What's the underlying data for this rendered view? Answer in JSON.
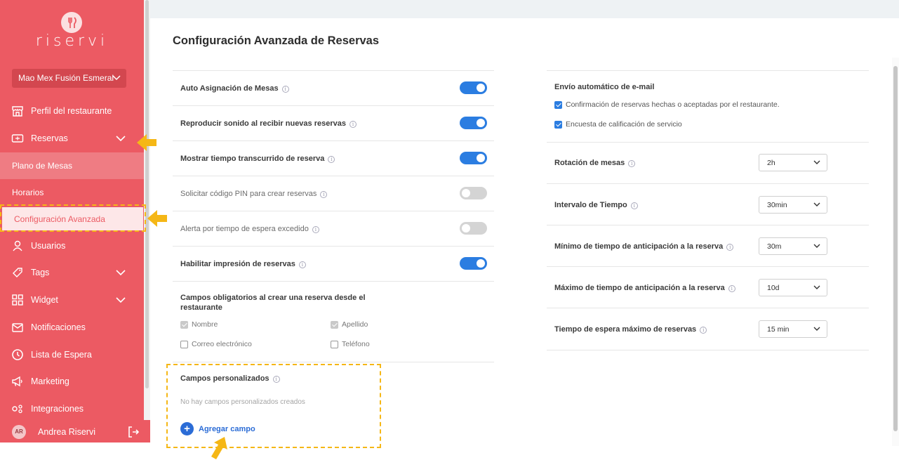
{
  "brand": {
    "name": "riservi",
    "color": "#ec5a63",
    "accent": "#2b7de1",
    "highlight": "#f5b716"
  },
  "sidebar": {
    "restaurant": "Mao Mex Fusión Esmeral",
    "items": [
      {
        "label": "Perfil del restaurante",
        "icon": "storefront-icon"
      },
      {
        "label": "Reservas",
        "icon": "ticket-icon"
      },
      {
        "label": "Usuarios",
        "icon": "user-icon"
      },
      {
        "label": "Tags",
        "icon": "tag-icon"
      },
      {
        "label": "Widget",
        "icon": "grid-icon"
      },
      {
        "label": "Notificaciones",
        "icon": "envelope-icon"
      },
      {
        "label": "Lista de Espera",
        "icon": "clock-icon"
      },
      {
        "label": "Marketing",
        "icon": "megaphone-icon"
      },
      {
        "label": "Integraciones",
        "icon": "integrations-icon"
      }
    ],
    "reservas_sub": [
      {
        "label": "Plano de Mesas"
      },
      {
        "label": "Horarios"
      },
      {
        "label": "Configuración Avanzada"
      }
    ],
    "user": {
      "initials": "AR",
      "name": "Andrea Riservi"
    }
  },
  "main": {
    "title": "Configuración Avanzada de Reservas",
    "toggles": [
      {
        "label": "Auto Asignación de Mesas",
        "on": true
      },
      {
        "label": "Reproducir sonido al recibir nuevas reservas",
        "on": true
      },
      {
        "label": "Mostrar tiempo transcurrido de reserva",
        "on": true
      },
      {
        "label": "Solicitar código PIN para crear reservas",
        "on": false
      },
      {
        "label": "Alerta por tiempo de espera excedido",
        "on": false
      },
      {
        "label": "Habilitar impresión de reservas",
        "on": true
      }
    ],
    "required_fields": {
      "title": "Campos obligatorios al crear una reserva desde el restaurante",
      "fields": [
        {
          "label": "Nombre",
          "checked": true
        },
        {
          "label": "Apellido",
          "checked": true
        },
        {
          "label": "Correo electrónico",
          "checked": false
        },
        {
          "label": "Teléfono",
          "checked": false
        }
      ]
    },
    "custom_fields": {
      "title": "Campos personalizados",
      "empty": "No hay campos personalizados creados",
      "add_label": "Agregar campo"
    },
    "email": {
      "title": "Envío automático de e-mail",
      "options": [
        {
          "label": "Confirmación de reservas hechas o aceptadas por el restaurante.",
          "checked": true
        },
        {
          "label": "Encuesta de calificación de servicio",
          "checked": true
        }
      ]
    },
    "selects": [
      {
        "label": "Rotación de mesas",
        "value": "2h"
      },
      {
        "label": "Intervalo de Tiempo",
        "value": "30min"
      },
      {
        "label": "Mínimo de tiempo de anticipación a la reserva",
        "value": "30m"
      },
      {
        "label": "Máximo de tiempo de anticipación a la reserva",
        "value": "10d"
      },
      {
        "label": "Tiempo de espera máximo de reservas",
        "value": "15 min"
      }
    ]
  }
}
